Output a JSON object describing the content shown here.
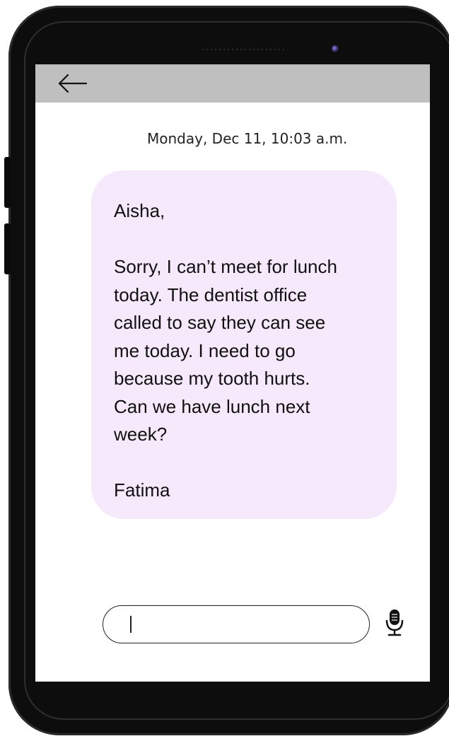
{
  "screen": {
    "header": {
      "back_icon": "arrow-left-icon"
    },
    "timestamp": "Monday, Dec 11, 10:03 a.m.",
    "message": {
      "greeting": "Aisha,",
      "body_lines": [
        "Sorry, I can’t meet for lunch",
        "today. The dentist office",
        "called to say they can see",
        "me today. I need to go",
        "because my tooth hurts.",
        "Can we have lunch next",
        "week?"
      ],
      "signature": "Fatima"
    },
    "composer": {
      "input_value": "",
      "mic_icon": "microphone-icon"
    }
  },
  "colors": {
    "header_bar": "#bfbfbf",
    "bubble": "#f6e9fb",
    "phone_body": "#0d0d0d"
  }
}
